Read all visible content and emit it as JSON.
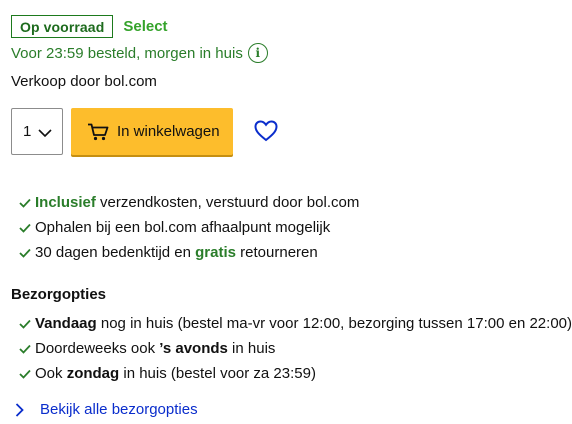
{
  "stock": {
    "badge": "Op voorraad",
    "select_label": "Select"
  },
  "delivery": {
    "text": "Voor 23:59 besteld, morgen in huis",
    "info_glyph": "i"
  },
  "seller": {
    "text": "Verkoop door bol.com"
  },
  "purchase": {
    "quantity": "1",
    "cart_button": "In winkelwagen"
  },
  "usps": [
    {
      "strong": "Inclusief",
      "after": " verzendkosten, verstuurd door bol.com"
    },
    {
      "text": "Ophalen bij een bol.com afhaalpunt mogelijk"
    },
    {
      "before": "30 dagen bedenktijd en ",
      "strong": "gratis",
      "after": " retourneren"
    }
  ],
  "bezorgopties": {
    "title": "Bezorgopties",
    "items": [
      {
        "before": "",
        "strong": "Vandaag",
        "after": " nog in huis (bestel ma-vr voor 12:00, bezorging tussen 17:00 en 22:00)"
      },
      {
        "before": "Doordeweeks ook ",
        "strong": "’s avonds",
        "after": " in huis"
      },
      {
        "before": "Ook ",
        "strong": "zondag",
        "after": " in huis (bestel voor za 23:59)"
      }
    ],
    "link": "Bekijk alle bezorgopties"
  },
  "colors": {
    "green": "#2a7d2a",
    "select_green": "#35a32b",
    "cart_yellow": "#fdbd2c",
    "link_blue": "#0a2dcc"
  }
}
